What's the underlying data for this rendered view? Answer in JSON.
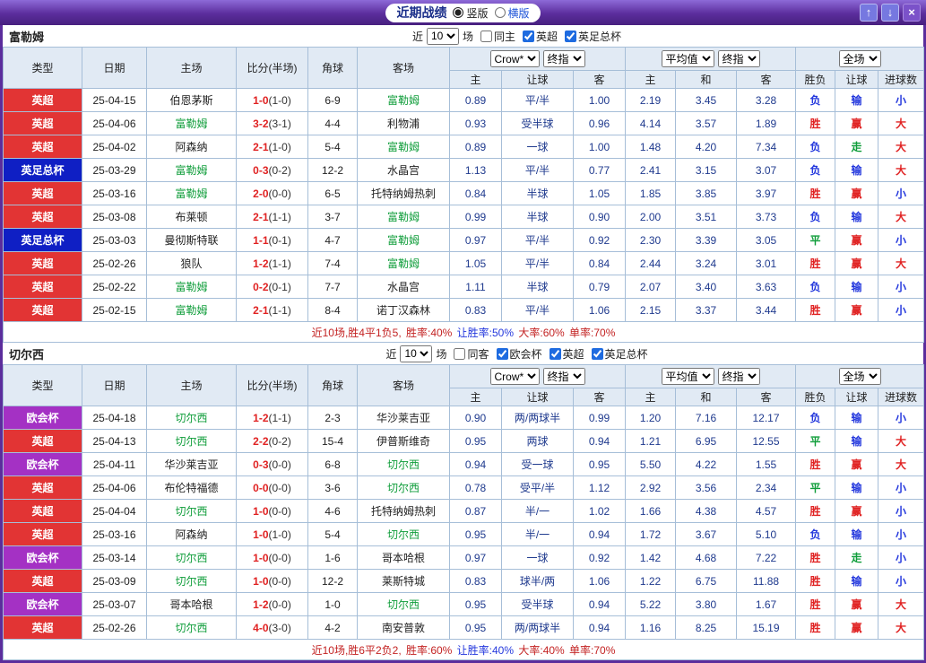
{
  "header": {
    "title": "近期战绩",
    "view_options": [
      {
        "label": "竖版",
        "selected": true
      },
      {
        "label": "横版",
        "selected": false
      }
    ],
    "window_buttons": {
      "up": "↑",
      "down": "↓",
      "close": "×"
    }
  },
  "colors": {
    "league": {
      "英超": "#e23434",
      "英足总杯": "#0f1fc4",
      "欧会杯": "#a431c4"
    },
    "result": {
      "胜": "#e02222",
      "平": "#0f9d3a",
      "负": "#2438dd",
      "赢": "#e02222",
      "走": "#0f9d3a",
      "输": "#2438dd",
      "大": "#e02222",
      "小": "#2438dd"
    },
    "team_highlight": "#0f9d3a"
  },
  "table_header": {
    "static_cols": [
      "类型",
      "日期",
      "主场",
      "比分(半场)",
      "角球",
      "客场"
    ],
    "group1": {
      "selects": [
        "Crow*",
        "终指"
      ],
      "cols": [
        "主",
        "让球",
        "客"
      ]
    },
    "group2": {
      "selects": [
        "平均值",
        "终指"
      ],
      "cols": [
        "主",
        "和",
        "客"
      ]
    },
    "group3": {
      "selects": [
        "全场"
      ],
      "cols": [
        "胜负",
        "让球",
        "进球数"
      ]
    }
  },
  "row_fields": [
    "league",
    "date",
    "home",
    "score",
    "half_score",
    "corners",
    "away",
    "ah_home",
    "ah_line",
    "ah_away",
    "eu_home",
    "eu_draw",
    "eu_away",
    "result_wdl",
    "result_handicap",
    "result_goals"
  ],
  "sections": [
    {
      "team": "富勒姆",
      "filter": {
        "prefix": "近",
        "count": "10",
        "suffix": "场",
        "checkboxes": [
          {
            "label": "同主",
            "checked": false
          },
          {
            "label": "英超",
            "checked": true
          },
          {
            "label": "英足总杯",
            "checked": true
          }
        ]
      },
      "rows": [
        [
          "英超",
          "25-04-15",
          "伯恩茅斯",
          "1-0",
          "(1-0)",
          "6-9",
          "富勒姆",
          "0.89",
          "平/半",
          "1.00",
          "2.19",
          "3.45",
          "3.28",
          "负",
          "输",
          "小"
        ],
        [
          "英超",
          "25-04-06",
          "富勒姆",
          "3-2",
          "(3-1)",
          "4-4",
          "利物浦",
          "0.93",
          "受半球",
          "0.96",
          "4.14",
          "3.57",
          "1.89",
          "胜",
          "赢",
          "大"
        ],
        [
          "英超",
          "25-04-02",
          "阿森纳",
          "2-1",
          "(1-0)",
          "5-4",
          "富勒姆",
          "0.89",
          "一球",
          "1.00",
          "1.48",
          "4.20",
          "7.34",
          "负",
          "走",
          "大"
        ],
        [
          "英足总杯",
          "25-03-29",
          "富勒姆",
          "0-3",
          "(0-2)",
          "12-2",
          "水晶宫",
          "1.13",
          "平/半",
          "0.77",
          "2.41",
          "3.15",
          "3.07",
          "负",
          "输",
          "大"
        ],
        [
          "英超",
          "25-03-16",
          "富勒姆",
          "2-0",
          "(0-0)",
          "6-5",
          "托特纳姆热刺",
          "0.84",
          "半球",
          "1.05",
          "1.85",
          "3.85",
          "3.97",
          "胜",
          "赢",
          "小"
        ],
        [
          "英超",
          "25-03-08",
          "布莱顿",
          "2-1",
          "(1-1)",
          "3-7",
          "富勒姆",
          "0.99",
          "半球",
          "0.90",
          "2.00",
          "3.51",
          "3.73",
          "负",
          "输",
          "大"
        ],
        [
          "英足总杯",
          "25-03-03",
          "曼彻斯特联",
          "1-1",
          "(0-1)",
          "4-7",
          "富勒姆",
          "0.97",
          "平/半",
          "0.92",
          "2.30",
          "3.39",
          "3.05",
          "平",
          "赢",
          "小"
        ],
        [
          "英超",
          "25-02-26",
          "狼队",
          "1-2",
          "(1-1)",
          "7-4",
          "富勒姆",
          "1.05",
          "平/半",
          "0.84",
          "2.44",
          "3.24",
          "3.01",
          "胜",
          "赢",
          "大"
        ],
        [
          "英超",
          "25-02-22",
          "富勒姆",
          "0-2",
          "(0-1)",
          "7-7",
          "水晶宫",
          "1.11",
          "半球",
          "0.79",
          "2.07",
          "3.40",
          "3.63",
          "负",
          "输",
          "小"
        ],
        [
          "英超",
          "25-02-15",
          "富勒姆",
          "2-1",
          "(1-1)",
          "8-4",
          "诺丁汉森林",
          "0.83",
          "平/半",
          "1.06",
          "2.15",
          "3.37",
          "3.44",
          "胜",
          "赢",
          "小"
        ]
      ],
      "summary": [
        {
          "text": "近10场,胜4平1负5, ",
          "color": "#c32222"
        },
        {
          "text": "胜率:40% ",
          "color": "#c32222"
        },
        {
          "text": "让胜率:50% ",
          "color": "#2438dd"
        },
        {
          "text": "大率:60% ",
          "color": "#c32222"
        },
        {
          "text": "单率:70%",
          "color": "#c32222"
        }
      ]
    },
    {
      "team": "切尔西",
      "filter": {
        "prefix": "近",
        "count": "10",
        "suffix": "场",
        "checkboxes": [
          {
            "label": "同客",
            "checked": false
          },
          {
            "label": "欧会杯",
            "checked": true
          },
          {
            "label": "英超",
            "checked": true
          },
          {
            "label": "英足总杯",
            "checked": true
          }
        ]
      },
      "rows": [
        [
          "欧会杯",
          "25-04-18",
          "切尔西",
          "1-2",
          "(1-1)",
          "2-3",
          "华沙莱吉亚",
          "0.90",
          "两/两球半",
          "0.99",
          "1.20",
          "7.16",
          "12.17",
          "负",
          "输",
          "小"
        ],
        [
          "英超",
          "25-04-13",
          "切尔西",
          "2-2",
          "(0-2)",
          "15-4",
          "伊普斯维奇",
          "0.95",
          "两球",
          "0.94",
          "1.21",
          "6.95",
          "12.55",
          "平",
          "输",
          "大"
        ],
        [
          "欧会杯",
          "25-04-11",
          "华沙莱吉亚",
          "0-3",
          "(0-0)",
          "6-8",
          "切尔西",
          "0.94",
          "受一球",
          "0.95",
          "5.50",
          "4.22",
          "1.55",
          "胜",
          "赢",
          "大"
        ],
        [
          "英超",
          "25-04-06",
          "布伦特福德",
          "0-0",
          "(0-0)",
          "3-6",
          "切尔西",
          "0.78",
          "受平/半",
          "1.12",
          "2.92",
          "3.56",
          "2.34",
          "平",
          "输",
          "小"
        ],
        [
          "英超",
          "25-04-04",
          "切尔西",
          "1-0",
          "(0-0)",
          "4-6",
          "托特纳姆热刺",
          "0.87",
          "半/一",
          "1.02",
          "1.66",
          "4.38",
          "4.57",
          "胜",
          "赢",
          "小"
        ],
        [
          "英超",
          "25-03-16",
          "阿森纳",
          "1-0",
          "(1-0)",
          "5-4",
          "切尔西",
          "0.95",
          "半/一",
          "0.94",
          "1.72",
          "3.67",
          "5.10",
          "负",
          "输",
          "小"
        ],
        [
          "欧会杯",
          "25-03-14",
          "切尔西",
          "1-0",
          "(0-0)",
          "1-6",
          "哥本哈根",
          "0.97",
          "一球",
          "0.92",
          "1.42",
          "4.68",
          "7.22",
          "胜",
          "走",
          "小"
        ],
        [
          "英超",
          "25-03-09",
          "切尔西",
          "1-0",
          "(0-0)",
          "12-2",
          "莱斯特城",
          "0.83",
          "球半/两",
          "1.06",
          "1.22",
          "6.75",
          "11.88",
          "胜",
          "输",
          "小"
        ],
        [
          "欧会杯",
          "25-03-07",
          "哥本哈根",
          "1-2",
          "(0-0)",
          "1-0",
          "切尔西",
          "0.95",
          "受半球",
          "0.94",
          "5.22",
          "3.80",
          "1.67",
          "胜",
          "赢",
          "大"
        ],
        [
          "英超",
          "25-02-26",
          "切尔西",
          "4-0",
          "(3-0)",
          "4-2",
          "南安普敦",
          "0.95",
          "两/两球半",
          "0.94",
          "1.16",
          "8.25",
          "15.19",
          "胜",
          "赢",
          "大"
        ]
      ],
      "summary": [
        {
          "text": "近10场,胜6平2负2, ",
          "color": "#c32222"
        },
        {
          "text": "胜率:60% ",
          "color": "#c32222"
        },
        {
          "text": "让胜率:40% ",
          "color": "#2438dd"
        },
        {
          "text": "大率:40% ",
          "color": "#c32222"
        },
        {
          "text": "单率:70%",
          "color": "#c32222"
        }
      ]
    }
  ]
}
